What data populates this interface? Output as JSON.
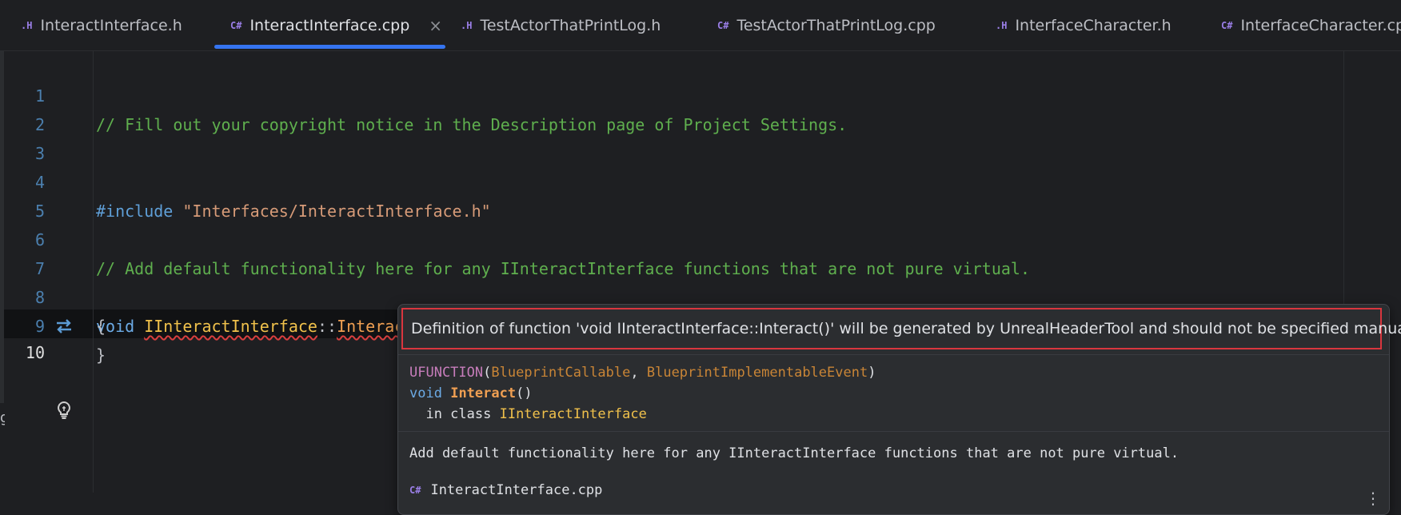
{
  "tabs": [
    {
      "prefix": ".H",
      "label": "InteractInterface.h"
    },
    {
      "prefix": "C#",
      "label": "InteractInterface.cpp",
      "close": "×"
    },
    {
      "prefix": ".H",
      "label": "TestActorThatPrintLog.h"
    },
    {
      "prefix": "C#",
      "label": "TestActorThatPrintLog.cpp"
    },
    {
      "prefix": ".H",
      "label": "InterfaceCharacter.h"
    },
    {
      "prefix": "C#",
      "label": "InterfaceCharacter.cpp"
    }
  ],
  "editor": {
    "line_numbers": [
      "1",
      "2",
      "3",
      "4",
      "5",
      "6",
      "7",
      "8",
      "9",
      "10"
    ],
    "line1": "// Fill out your copyright notice in the Description page of Project Settings.",
    "line4_directive": "#include",
    "line4_string": "\"Interfaces/InteractInterface.h\"",
    "line6": "// Add default functionality here for any IInteractInterface functions that are not pure virtual.",
    "line7_kw": "void",
    "line7_class": "IInteractInterface",
    "line7_sep": "::",
    "line7_func": "Interact",
    "line7_parens": "()",
    "line8": "{",
    "line9": "}"
  },
  "popup": {
    "error": "Definition of function 'void IInteractInterface::Interact()' will be generated by UnrealHeaderTool and should not be specified manually",
    "macro": "UFUNCTION",
    "open_paren": "(",
    "arg1": "BlueprintCallable",
    "comma": ", ",
    "arg2": "BlueprintImplementableEvent",
    "close_paren": ")",
    "sig_kw": "void",
    "sig_fn": "Interact",
    "sig_parens": "()",
    "in_class_text": "  in class ",
    "class_name": "IInteractInterface",
    "doc": "Add default functionality here for any IInteractInterface functions that are not pure virtual.",
    "file": "InteractInterface.cpp",
    "file_prefix": "C#",
    "more": "⋮"
  },
  "edge_char": "g"
}
